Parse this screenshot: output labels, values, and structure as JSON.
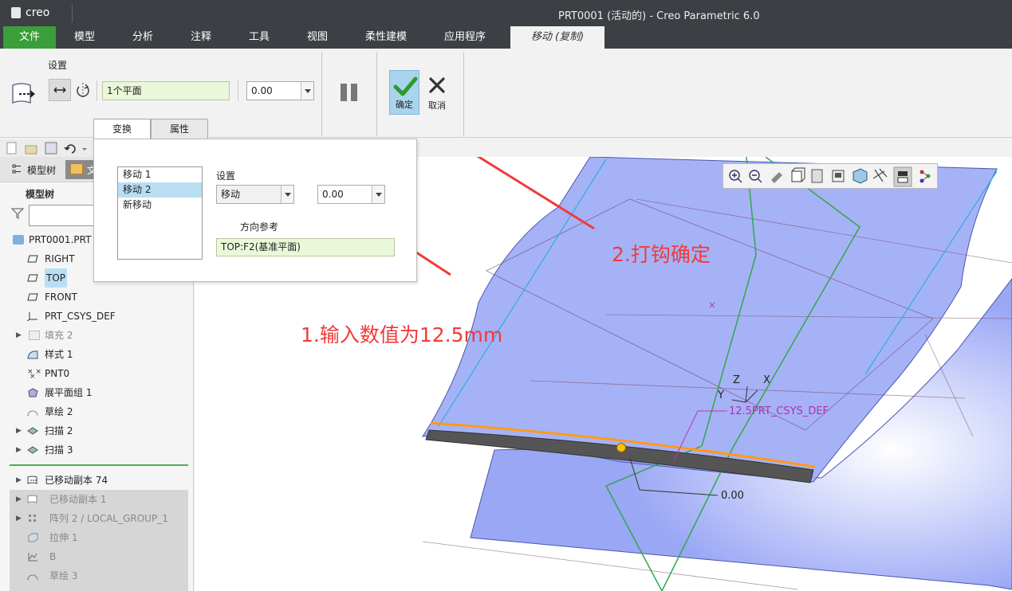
{
  "app": {
    "logo": "creo",
    "window_title": "PRT0001 (活动的) - Creo Parametric 6.0"
  },
  "menu": {
    "tabs": [
      "文件",
      "模型",
      "分析",
      "注释",
      "工具",
      "视图",
      "柔性建模",
      "应用程序",
      "移动 (复制)"
    ]
  },
  "ribbon": {
    "settings_label": "设置",
    "reference_value": "1个平面",
    "distance_value": "0.00",
    "confirm_label": "确定",
    "cancel_label": "取消",
    "subtabs": [
      "变换",
      "属性"
    ]
  },
  "popup": {
    "moves": [
      "移动 1",
      "移动 2",
      "新移动"
    ],
    "settings_label": "设置",
    "type_value": "移动",
    "distance_value": "0.00",
    "direction_label": "方向参考",
    "direction_value": "TOP:F2(基准平面)"
  },
  "left_panel": {
    "tab_model_tree": "模型树",
    "tab_files_partial": "文",
    "header": "模型树",
    "items": [
      {
        "label": "PRT0001.PRT"
      },
      {
        "label": "RIGHT"
      },
      {
        "label": "TOP"
      },
      {
        "label": "FRONT"
      },
      {
        "label": "PRT_CSYS_DEF"
      },
      {
        "label": "填充 2"
      },
      {
        "label": "样式 1"
      },
      {
        "label": "PNT0"
      },
      {
        "label": "展平面组 1"
      },
      {
        "label": "草绘 2"
      },
      {
        "label": "扫描 2"
      },
      {
        "label": "扫描 3"
      },
      {
        "label": "已移动副本 74"
      },
      {
        "label": "已移动副本 1"
      },
      {
        "label": "阵列 2 / LOCAL_GROUP_1"
      },
      {
        "label": "拉伸 1"
      },
      {
        "label": "B"
      },
      {
        "label": "草绘 3"
      }
    ]
  },
  "viewport": {
    "axis_z": "Z",
    "axis_x": "X",
    "axis_y": "Y",
    "dim_label_1": "12.5PRT_CSYS_DEF",
    "dim_label_2": "0.00"
  },
  "annotations": {
    "step1": "1.输入数值为12.5mm",
    "step2": "2.打钩确定"
  },
  "colors": {
    "accent_green": "#3a9e3a",
    "annotation_red": "#f23a3a",
    "surface_blue": "#9aa7f5",
    "selection_blue": "#b9def4"
  }
}
